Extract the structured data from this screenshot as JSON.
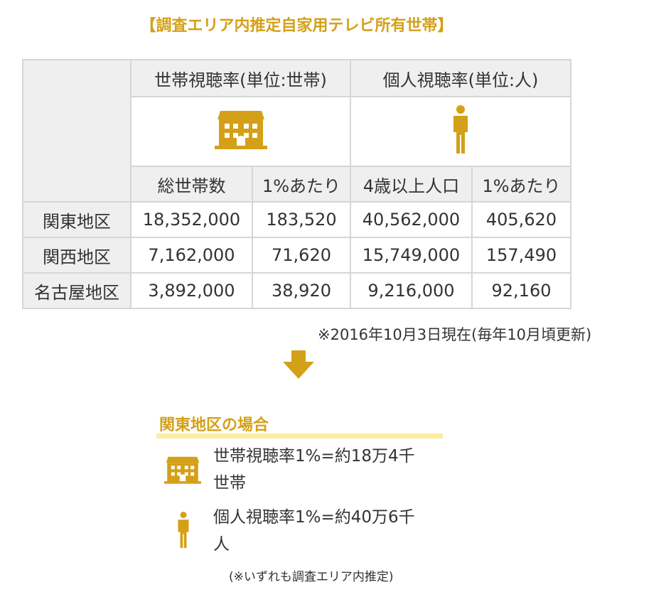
{
  "title": "【調査エリア内推定自家用テレビ所有世帯】",
  "table": {
    "household_header": "世帯視聴率(単位:世帯)",
    "individual_header": "個人視聴率(単位:人)",
    "subheaders": [
      "総世帯数",
      "1%あたり",
      "4歳以上人口",
      "1%あたり"
    ],
    "rows": [
      {
        "region": "関東地区",
        "values": [
          "18,352,000",
          "183,520",
          "40,562,000",
          "405,620"
        ]
      },
      {
        "region": "関西地区",
        "values": [
          "7,162,000",
          "71,620",
          "15,749,000",
          "157,490"
        ]
      },
      {
        "region": "名古屋地区",
        "values": [
          "3,892,000",
          "38,920",
          "9,216,000",
          "92,160"
        ]
      }
    ]
  },
  "note": "※2016年10月3日現在(毎年10月頃更新)",
  "kanto": {
    "heading": "関東地区の場合",
    "household_line1": "世帯視聴率1%=約18万4千",
    "household_line2": "世帯",
    "individual_line1": "個人視聴率1%=約40万6千",
    "individual_line2": "人"
  },
  "footnote": "(※いずれも調査エリア内推定)",
  "colors": {
    "accent": "#d4a017",
    "highlight": "#fbeea0",
    "header_bg": "#efefef",
    "border": "#d6d6d6"
  },
  "icons": [
    "house-icon",
    "person-icon",
    "arrow-down-icon"
  ]
}
